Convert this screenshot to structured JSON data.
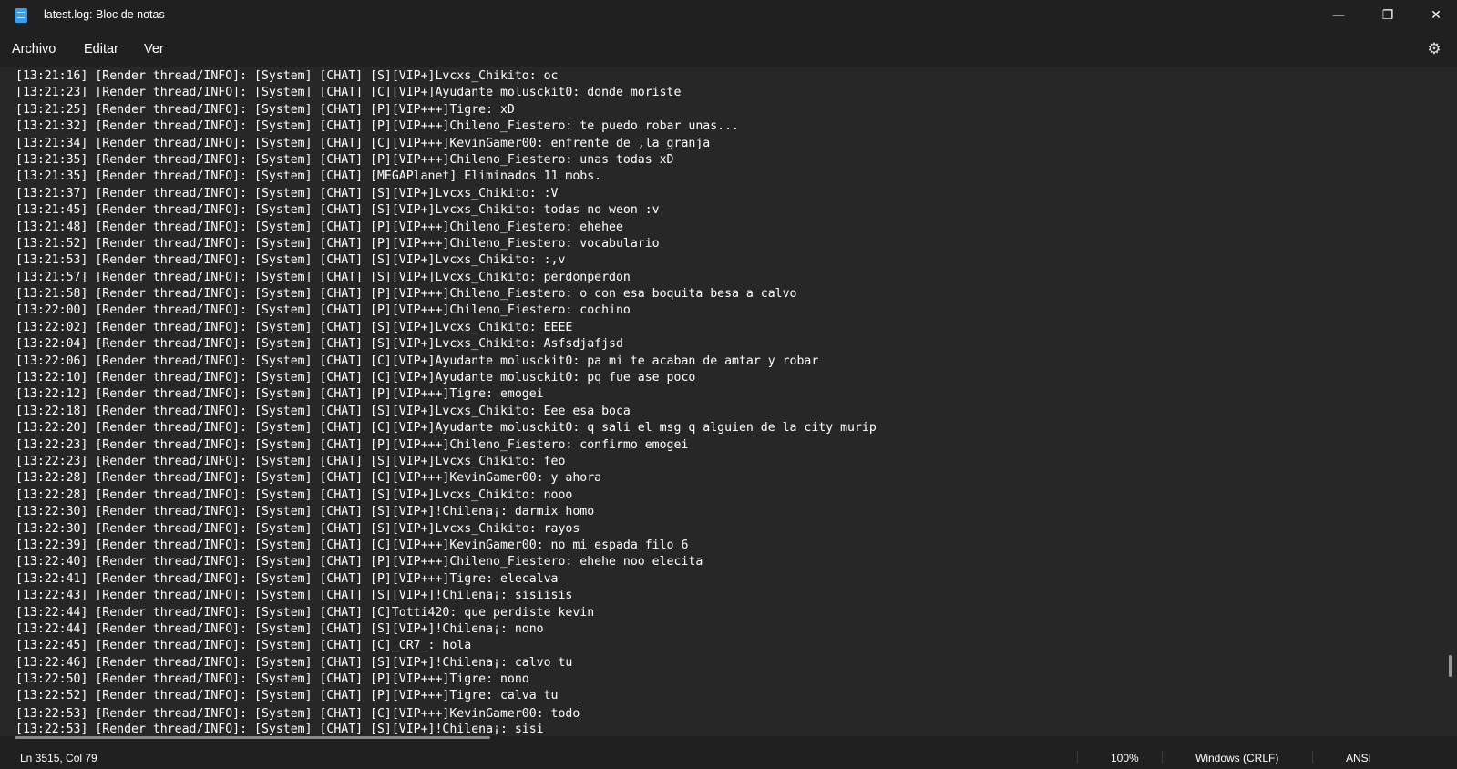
{
  "window": {
    "title": "latest.log: Bloc de notas"
  },
  "menu": {
    "file": "Archivo",
    "edit": "Editar",
    "view": "Ver"
  },
  "editor": {
    "lines": [
      "[13:21:16] [Render thread/INFO]: [System] [CHAT] [S][VIP+]Lvcxs_Chikito: oc",
      "[13:21:23] [Render thread/INFO]: [System] [CHAT] [C][VIP+]Ayudante molusckit0: donde moriste",
      "[13:21:25] [Render thread/INFO]: [System] [CHAT] [P][VIP+++]Tigre: xD",
      "[13:21:32] [Render thread/INFO]: [System] [CHAT] [P][VIP+++]Chileno_Fiestero: te puedo robar unas...",
      "[13:21:34] [Render thread/INFO]: [System] [CHAT] [C][VIP+++]KevinGamer00: enfrente de ,la granja",
      "[13:21:35] [Render thread/INFO]: [System] [CHAT] [P][VIP+++]Chileno_Fiestero: unas todas xD",
      "[13:21:35] [Render thread/INFO]: [System] [CHAT] [MEGAPlanet] Eliminados 11 mobs.",
      "[13:21:37] [Render thread/INFO]: [System] [CHAT] [S][VIP+]Lvcxs_Chikito: :V",
      "[13:21:45] [Render thread/INFO]: [System] [CHAT] [S][VIP+]Lvcxs_Chikito: todas no weon :v",
      "[13:21:48] [Render thread/INFO]: [System] [CHAT] [P][VIP+++]Chileno_Fiestero: ehehee",
      "[13:21:52] [Render thread/INFO]: [System] [CHAT] [P][VIP+++]Chileno_Fiestero: vocabulario",
      "[13:21:53] [Render thread/INFO]: [System] [CHAT] [S][VIP+]Lvcxs_Chikito: :,v",
      "[13:21:57] [Render thread/INFO]: [System] [CHAT] [S][VIP+]Lvcxs_Chikito: perdonperdon",
      "[13:21:58] [Render thread/INFO]: [System] [CHAT] [P][VIP+++]Chileno_Fiestero: o con esa boquita besa a calvo",
      "[13:22:00] [Render thread/INFO]: [System] [CHAT] [P][VIP+++]Chileno_Fiestero: cochino",
      "[13:22:02] [Render thread/INFO]: [System] [CHAT] [S][VIP+]Lvcxs_Chikito: EEEE",
      "[13:22:04] [Render thread/INFO]: [System] [CHAT] [S][VIP+]Lvcxs_Chikito: Asfsdjafjsd",
      "[13:22:06] [Render thread/INFO]: [System] [CHAT] [C][VIP+]Ayudante molusckit0: pa mi te acaban de amtar y robar",
      "[13:22:10] [Render thread/INFO]: [System] [CHAT] [C][VIP+]Ayudante molusckit0: pq fue ase poco",
      "[13:22:12] [Render thread/INFO]: [System] [CHAT] [P][VIP+++]Tigre: emogei",
      "[13:22:18] [Render thread/INFO]: [System] [CHAT] [S][VIP+]Lvcxs_Chikito: Eee esa boca",
      "[13:22:20] [Render thread/INFO]: [System] [CHAT] [C][VIP+]Ayudante molusckit0: q sali el msg q alguien de la city murip",
      "[13:22:23] [Render thread/INFO]: [System] [CHAT] [P][VIP+++]Chileno_Fiestero: confirmo emogei",
      "[13:22:23] [Render thread/INFO]: [System] [CHAT] [S][VIP+]Lvcxs_Chikito: feo",
      "[13:22:28] [Render thread/INFO]: [System] [CHAT] [C][VIP+++]KevinGamer00: y ahora",
      "[13:22:28] [Render thread/INFO]: [System] [CHAT] [S][VIP+]Lvcxs_Chikito: nooo",
      "[13:22:30] [Render thread/INFO]: [System] [CHAT] [S][VIP+]!Chilena¡: darmix homo",
      "[13:22:30] [Render thread/INFO]: [System] [CHAT] [S][VIP+]Lvcxs_Chikito: rayos",
      "[13:22:39] [Render thread/INFO]: [System] [CHAT] [C][VIP+++]KevinGamer00: no mi espada filo 6",
      "[13:22:40] [Render thread/INFO]: [System] [CHAT] [P][VIP+++]Chileno_Fiestero: ehehe noo elecita",
      "[13:22:41] [Render thread/INFO]: [System] [CHAT] [P][VIP+++]Tigre: elecalva",
      "[13:22:43] [Render thread/INFO]: [System] [CHAT] [S][VIP+]!Chilena¡: sisiisis",
      "[13:22:44] [Render thread/INFO]: [System] [CHAT] [C]Totti420: que perdiste kevin",
      "[13:22:44] [Render thread/INFO]: [System] [CHAT] [S][VIP+]!Chilena¡: nono",
      "[13:22:45] [Render thread/INFO]: [System] [CHAT] [C]_CR7_: hola",
      "[13:22:46] [Render thread/INFO]: [System] [CHAT] [S][VIP+]!Chilena¡: calvo tu",
      "[13:22:50] [Render thread/INFO]: [System] [CHAT] [P][VIP+++]Tigre: nono",
      "[13:22:52] [Render thread/INFO]: [System] [CHAT] [P][VIP+++]Tigre: calva tu",
      "[13:22:53] [Render thread/INFO]: [System] [CHAT] [C][VIP+++]KevinGamer00: todo",
      "[13:22:53] [Render thread/INFO]: [System] [CHAT] [S][VIP+]!Chilena¡: sisi"
    ]
  },
  "status": {
    "position": "Ln 3515, Col 79",
    "zoom": "100%",
    "line_ending": "Windows (CRLF)",
    "encoding": "ANSI"
  },
  "icons": {
    "app": "notepad-icon",
    "settings": "gear-icon",
    "minimize": "minimize-icon",
    "maximize": "restore-icon",
    "close": "close-icon"
  }
}
